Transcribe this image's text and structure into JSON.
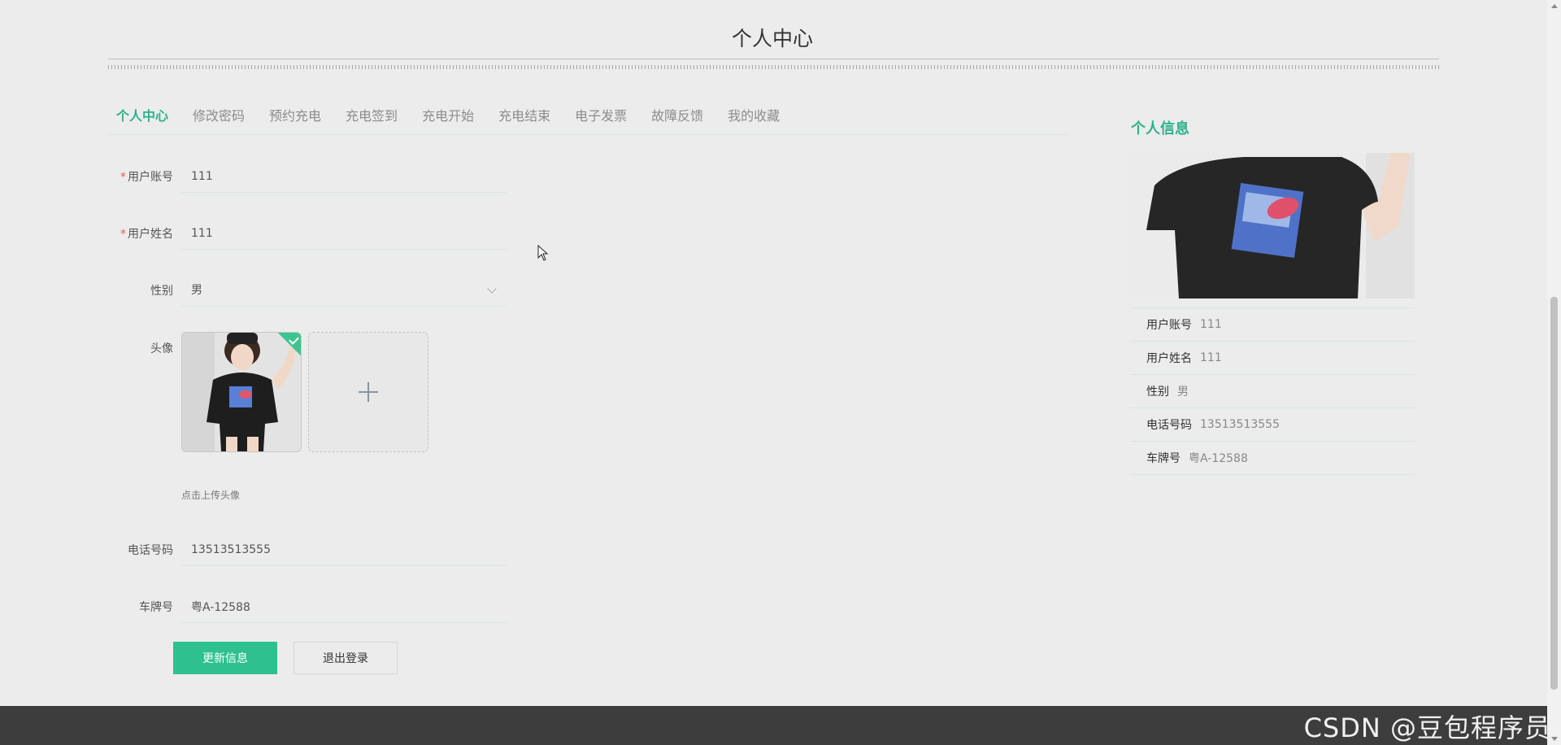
{
  "page": {
    "title": "个人中心"
  },
  "tabs": [
    {
      "label": "个人中心",
      "active": true
    },
    {
      "label": "修改密码",
      "active": false
    },
    {
      "label": "预约充电",
      "active": false
    },
    {
      "label": "充电签到",
      "active": false
    },
    {
      "label": "充电开始",
      "active": false
    },
    {
      "label": "充电结束",
      "active": false
    },
    {
      "label": "电子发票",
      "active": false
    },
    {
      "label": "故障反馈",
      "active": false
    },
    {
      "label": "我的收藏",
      "active": false
    }
  ],
  "form": {
    "required_mark": "*",
    "account": {
      "label": "用户账号",
      "value": "111"
    },
    "name": {
      "label": "用户姓名",
      "value": "111"
    },
    "gender": {
      "label": "性别",
      "value": "男"
    },
    "avatar": {
      "label": "头像",
      "hint": "点击上传头像"
    },
    "phone": {
      "label": "电话号码",
      "value": "13513513555"
    },
    "plate": {
      "label": "车牌号",
      "value": "粤A-12588"
    },
    "update_button": "更新信息",
    "logout_button": "退出登录"
  },
  "info_panel": {
    "title": "个人信息",
    "items": [
      {
        "key": "用户账号",
        "value": "111"
      },
      {
        "key": "用户姓名",
        "value": "111"
      },
      {
        "key": "性别",
        "value": "男"
      },
      {
        "key": "电话号码",
        "value": "13513513555"
      },
      {
        "key": "车牌号",
        "value": "粤A-12588"
      }
    ]
  },
  "watermark": "CSDN @豆包程序员",
  "colors": {
    "accent": "#2db28b",
    "primary_button": "#2ec08f",
    "footer": "#3d3d3d",
    "background": "#ececec"
  },
  "icons": {
    "gender_select": "chevron-down-icon",
    "upload": "plus-icon",
    "uploaded": "check-icon"
  }
}
